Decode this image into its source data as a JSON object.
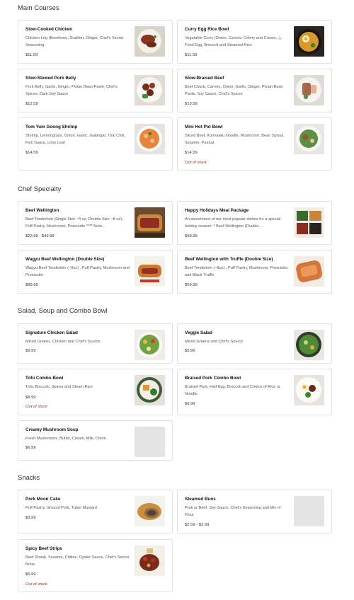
{
  "sections": [
    {
      "title": "Main Courses",
      "items": [
        {
          "name": "Slow-Cooked Chicken",
          "desc": "Chicken Leg (Boneless), Scallion, Ginger, Chef's Secret Seasoning",
          "price": "$11.59",
          "oos": "",
          "image": "chicken-plate"
        },
        {
          "name": "Curry Egg Rice Bowl",
          "desc": "Vegetable Curry (Onion, Carrots, Celery and Cream,..), Fried Egg, Broccoli and Steamed Rice",
          "price": "$11.59",
          "oos": "",
          "image": "curry-bowl"
        },
        {
          "name": "Slow-Stewed Pork Belly",
          "desc": "Pork Belly, Garlic, Ginger, Pixian Bean Paste, Chef's Spices, Dark Soy Sauce",
          "price": "$12.59",
          "oos": "",
          "image": "pork-plate"
        },
        {
          "name": "Slow-Braised Beef",
          "desc": "Beef Chuck, Carrots, Onion, Garlic, Ginger, Pixian Bean Paste, Soy Sauce, Chef's Spices",
          "price": "$13.59",
          "oos": "",
          "image": "beef-plate"
        },
        {
          "name": "Tom Yum Goong Shrimp",
          "desc": "Shrimp, Lemongrass, Onion, Garlic, Galangal, Thai Chili, Fish Sauce, Lime Leaf",
          "price": "$14.59",
          "oos": "",
          "image": "soup-bowl"
        },
        {
          "name": "Mini Hot Pot Bowl",
          "desc": "Sliced Beef, Konnyaku Noodle, Mushroom, Bean Sprout, Sesame, Peanut",
          "price": "$14.59",
          "oos": "Out of stock",
          "image": "hotpot-bowl"
        }
      ]
    },
    {
      "title": "Chef Specialty",
      "items": [
        {
          "name": "Beef Wellington",
          "desc": "Beef Tenderloin (Single Size ~4 oz, Double Size ~8 oz), Puff Pastry, Mushroom, Prosciutto **** Noto...",
          "price": "$22.99 - $49.99",
          "oos": "",
          "image": "wellington"
        },
        {
          "name": "Happy Holidays Meal Package",
          "desc": "An assortment of our most popular dishes for a special holiday season: * Beef Wellington (Double...",
          "price": "$99.99",
          "oos": "",
          "image": "holiday-box"
        },
        {
          "name": "Wagyu Beef Wellington (Double Size)",
          "desc": "Wagyu Beef Tenderloin (~8oz) , Puff Pastry, Mushroom and Prosciutto",
          "price": "$99.99",
          "oos": "",
          "image": "wagyu-wellington"
        },
        {
          "name": "Beef Wellington with Truffle (Double Size)",
          "desc": "Beef Tenderloin (~8oz) , Puff Pastry, Mushroom, Prosciutto and Black Truffle",
          "price": "$59.99",
          "oos": "",
          "image": "truffle-wellington"
        }
      ]
    },
    {
      "title": "Salad, Soup and Combo Bowl",
      "items": [
        {
          "name": "Signature Chicken Salad",
          "desc": "Mixed Greens, Chicken and Chef's Source",
          "price": "$9.99",
          "oos": "",
          "image": "chicken-salad"
        },
        {
          "name": "Veggie Salad",
          "desc": "Mixed Greens and Chef's Source",
          "price": "$5.99",
          "oos": "",
          "image": "veggie-salad"
        },
        {
          "name": "Tofu Combo Bowl",
          "desc": "Tofu, Broccoli, Spices and Steam Rice",
          "price": "$8.99",
          "oos": "Out of stock",
          "image": "tofu-bowl"
        },
        {
          "name": "Braised Pork Combo Bowl",
          "desc": "Braised Pork, Half Egg, Broccoli and Choice of Rice or Noodle",
          "price": "$9.99",
          "oos": "",
          "image": "pork-bowl"
        },
        {
          "name": "Creamy Mushroom Soup",
          "desc": "Fresh Mushrooms, Butter, Cream, Milk, Onion",
          "price": "$6.99",
          "oos": "",
          "image": "placeholder"
        }
      ]
    },
    {
      "title": "Snacks",
      "items": [
        {
          "name": "Pork Moon Cake",
          "desc": "Puff Pastry, Ground Pork, Tuber Mustard",
          "price": "$3.99",
          "oos": "",
          "image": "moon-cake"
        },
        {
          "name": "Steamed Buns",
          "desc": "Pork or Beef, Soy Sauce, Chef's Seasoning and Mix of Flour",
          "price": "$2.59 - $2.99",
          "oos": "",
          "image": "placeholder"
        },
        {
          "name": "Spicy Beef Strips",
          "desc": "Beef Shank, Sesame, Chilies, Oyster Sauce, Chef's Secret Brine",
          "price": "$6.99",
          "oos": "Out of stock",
          "image": "beef-strips"
        }
      ]
    }
  ],
  "colors": {
    "card_border": "#e2e2e2",
    "out_of_stock": "#8a3a2a",
    "placeholder": "#e3e3e3"
  }
}
